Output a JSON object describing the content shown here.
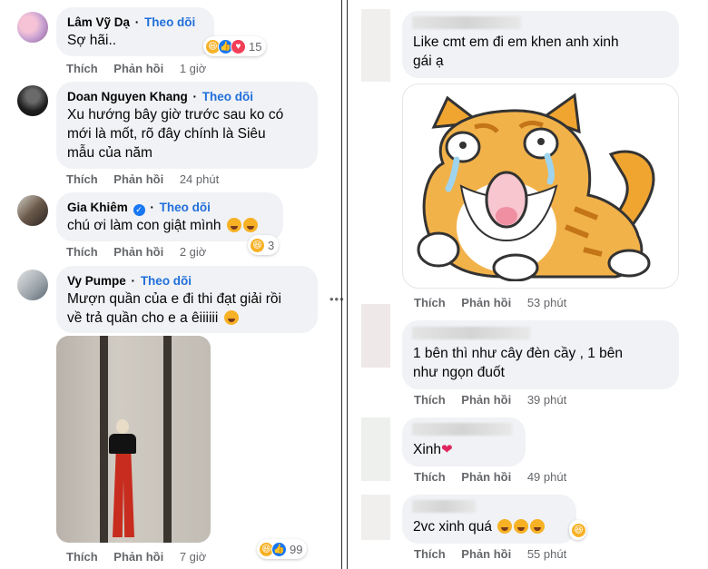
{
  "left": {
    "comments": [
      {
        "author": "Lâm Vỹ Dạ",
        "follow": "Theo dõi",
        "text": "Sợ hãi..",
        "actions": {
          "like": "Thích",
          "reply": "Phản hồi",
          "time": "1 giờ"
        },
        "reaction_count": "15"
      },
      {
        "author": "Doan Nguyen Khang",
        "follow": "Theo dõi",
        "text_lines": [
          "Xu hướng bây giờ trước sau ko có",
          "mới là mốt, rõ đây chính là Siêu",
          "mẫu của năm"
        ],
        "actions": {
          "like": "Thích",
          "reply": "Phản hồi",
          "time": "24 phút"
        }
      },
      {
        "author": "Gia Khiêm",
        "follow": "Theo dõi",
        "text": "chú ơi làm con giật mình",
        "actions": {
          "like": "Thích",
          "reply": "Phản hồi",
          "time": "2 giờ"
        },
        "reaction_count": "3"
      },
      {
        "author": "Vy Pumpe",
        "follow": "Theo dõi",
        "text_lines": [
          "Mượn quần của e đi thi đạt giải rồi",
          "về trả quần cho e a êiiiiii"
        ],
        "actions": {
          "like": "Thích",
          "reply": "Phản hồi",
          "time": "7 giờ"
        },
        "reaction_count": "99"
      }
    ]
  },
  "right": {
    "comments": [
      {
        "text_lines": [
          "Like cmt em đi em khen anh xinh",
          "gái ạ"
        ],
        "actions": {
          "like": "Thích",
          "reply": "Phản hồi",
          "time": "53 phút"
        }
      },
      {
        "text_lines": [
          "1 bên thì như cây đèn cầy , 1 bên",
          "như ngọn đuốt"
        ],
        "actions": {
          "like": "Thích",
          "reply": "Phản hồi",
          "time": "39 phút"
        }
      },
      {
        "text": "Xinh",
        "actions": {
          "like": "Thích",
          "reply": "Phản hồi",
          "time": "49 phút"
        }
      },
      {
        "text": "2vc xinh quá",
        "actions": {
          "like": "Thích",
          "reply": "Phản hồi",
          "time": "55 phút"
        }
      }
    ]
  },
  "colors": {
    "bubble": "#f0f2f5",
    "follow": "#216fdb",
    "meta": "#65676b",
    "haha": "#f7b125",
    "like": "#1877f2",
    "care": "#f33e58"
  },
  "icons": [
    "haha-icon",
    "like-icon",
    "care-icon",
    "verified-icon",
    "heart-icon",
    "more-icon"
  ]
}
